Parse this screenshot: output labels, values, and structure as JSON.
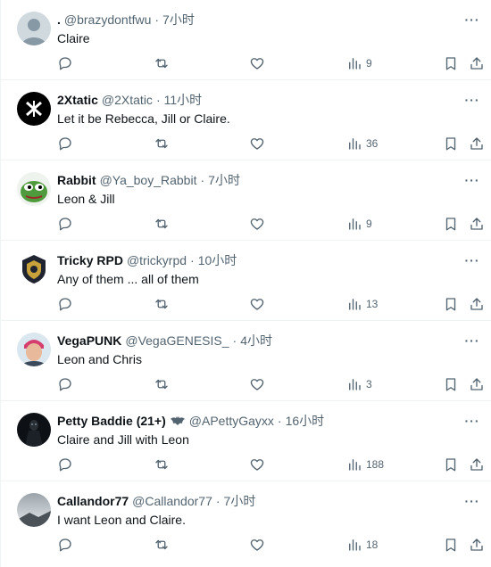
{
  "replies": [
    {
      "name": ".",
      "handle": "@brazydontfwu",
      "time": "7小时",
      "text": "Claire",
      "views": "9"
    },
    {
      "name": "2Xtatic",
      "handle": "@2Xtatic",
      "time": "11小时",
      "text": "Let it be Rebecca, Jill or Claire.",
      "views": "36"
    },
    {
      "name": "Rabbit",
      "handle": "@Ya_boy_Rabbit",
      "time": "7小时",
      "text": "Leon & Jill",
      "views": "9"
    },
    {
      "name": "Tricky RPD",
      "handle": "@trickyrpd",
      "time": "10小时",
      "text": "Any of them ... all of them",
      "views": "13"
    },
    {
      "name": "VegaPUNK",
      "handle": "@VegaGENESIS_",
      "time": "4小时",
      "text": "Leon and Chris",
      "views": "3"
    },
    {
      "name": "Petty Baddie (21+)",
      "handle": "@APettyGayxx",
      "time": "16小时",
      "text": "Claire and Jill with Leon",
      "views": "188"
    },
    {
      "name": "Callandor77",
      "handle": "@Callandor77",
      "time": "7小时",
      "text": "I want Leon and Claire.",
      "views": "18"
    }
  ]
}
